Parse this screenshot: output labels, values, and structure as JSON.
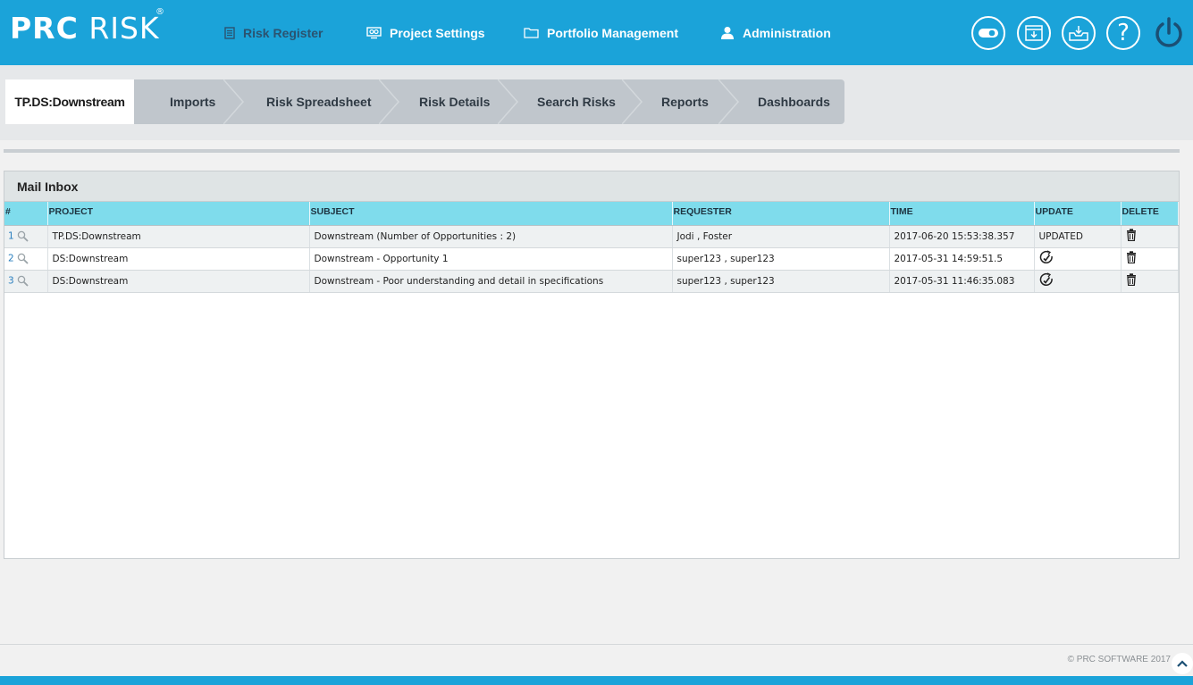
{
  "header": {
    "logo_bold": "PRC",
    "logo_thin": "RISK",
    "logo_reg": "®",
    "nav": [
      {
        "label": "Risk Register",
        "icon": "list-icon",
        "active": true
      },
      {
        "label": "Project Settings",
        "icon": "settings-monitor-icon"
      },
      {
        "label": "Portfolio Management",
        "icon": "folder-icon"
      },
      {
        "label": "Administration",
        "icon": "user-icon"
      }
    ],
    "buttons": [
      "toggle-icon",
      "calendar-download-icon",
      "inbox-download-icon",
      "help-icon",
      "power-icon"
    ],
    "help_glyph": "?"
  },
  "tabs": {
    "active": "TP.DS:Downstream",
    "items": [
      "Imports",
      "Risk Spreadsheet",
      "Risk Details",
      "Search Risks",
      "Reports",
      "Dashboards"
    ]
  },
  "inbox": {
    "title": "Mail Inbox",
    "columns": [
      "#",
      "PROJECT",
      "SUBJECT",
      "REQUESTER",
      "TIME",
      "UPDATE",
      "DELETE"
    ],
    "rows": [
      {
        "num": "1",
        "project": "TP.DS:Downstream",
        "subject": "Downstream (Number of Opportunities : 2)",
        "requester": "Jodi , Foster",
        "time": "2017-06-20 15:53:38.357",
        "update": "UPDATED"
      },
      {
        "num": "2",
        "project": "DS:Downstream",
        "subject": "Downstream - Opportunity 1",
        "requester": "super123 , super123",
        "time": "2017-05-31 14:59:51.5",
        "update": ""
      },
      {
        "num": "3",
        "project": "DS:Downstream",
        "subject": "Downstream - Poor understanding and detail in specifications",
        "requester": "super123 , super123",
        "time": "2017-05-31 11:46:35.083",
        "update": ""
      }
    ]
  },
  "footer": {
    "copyright": "© PRC SOFTWARE 2017"
  },
  "colors": {
    "brand_blue": "#1ba3d9",
    "table_header": "#7fdcec",
    "active_nav": "#2b5370"
  }
}
